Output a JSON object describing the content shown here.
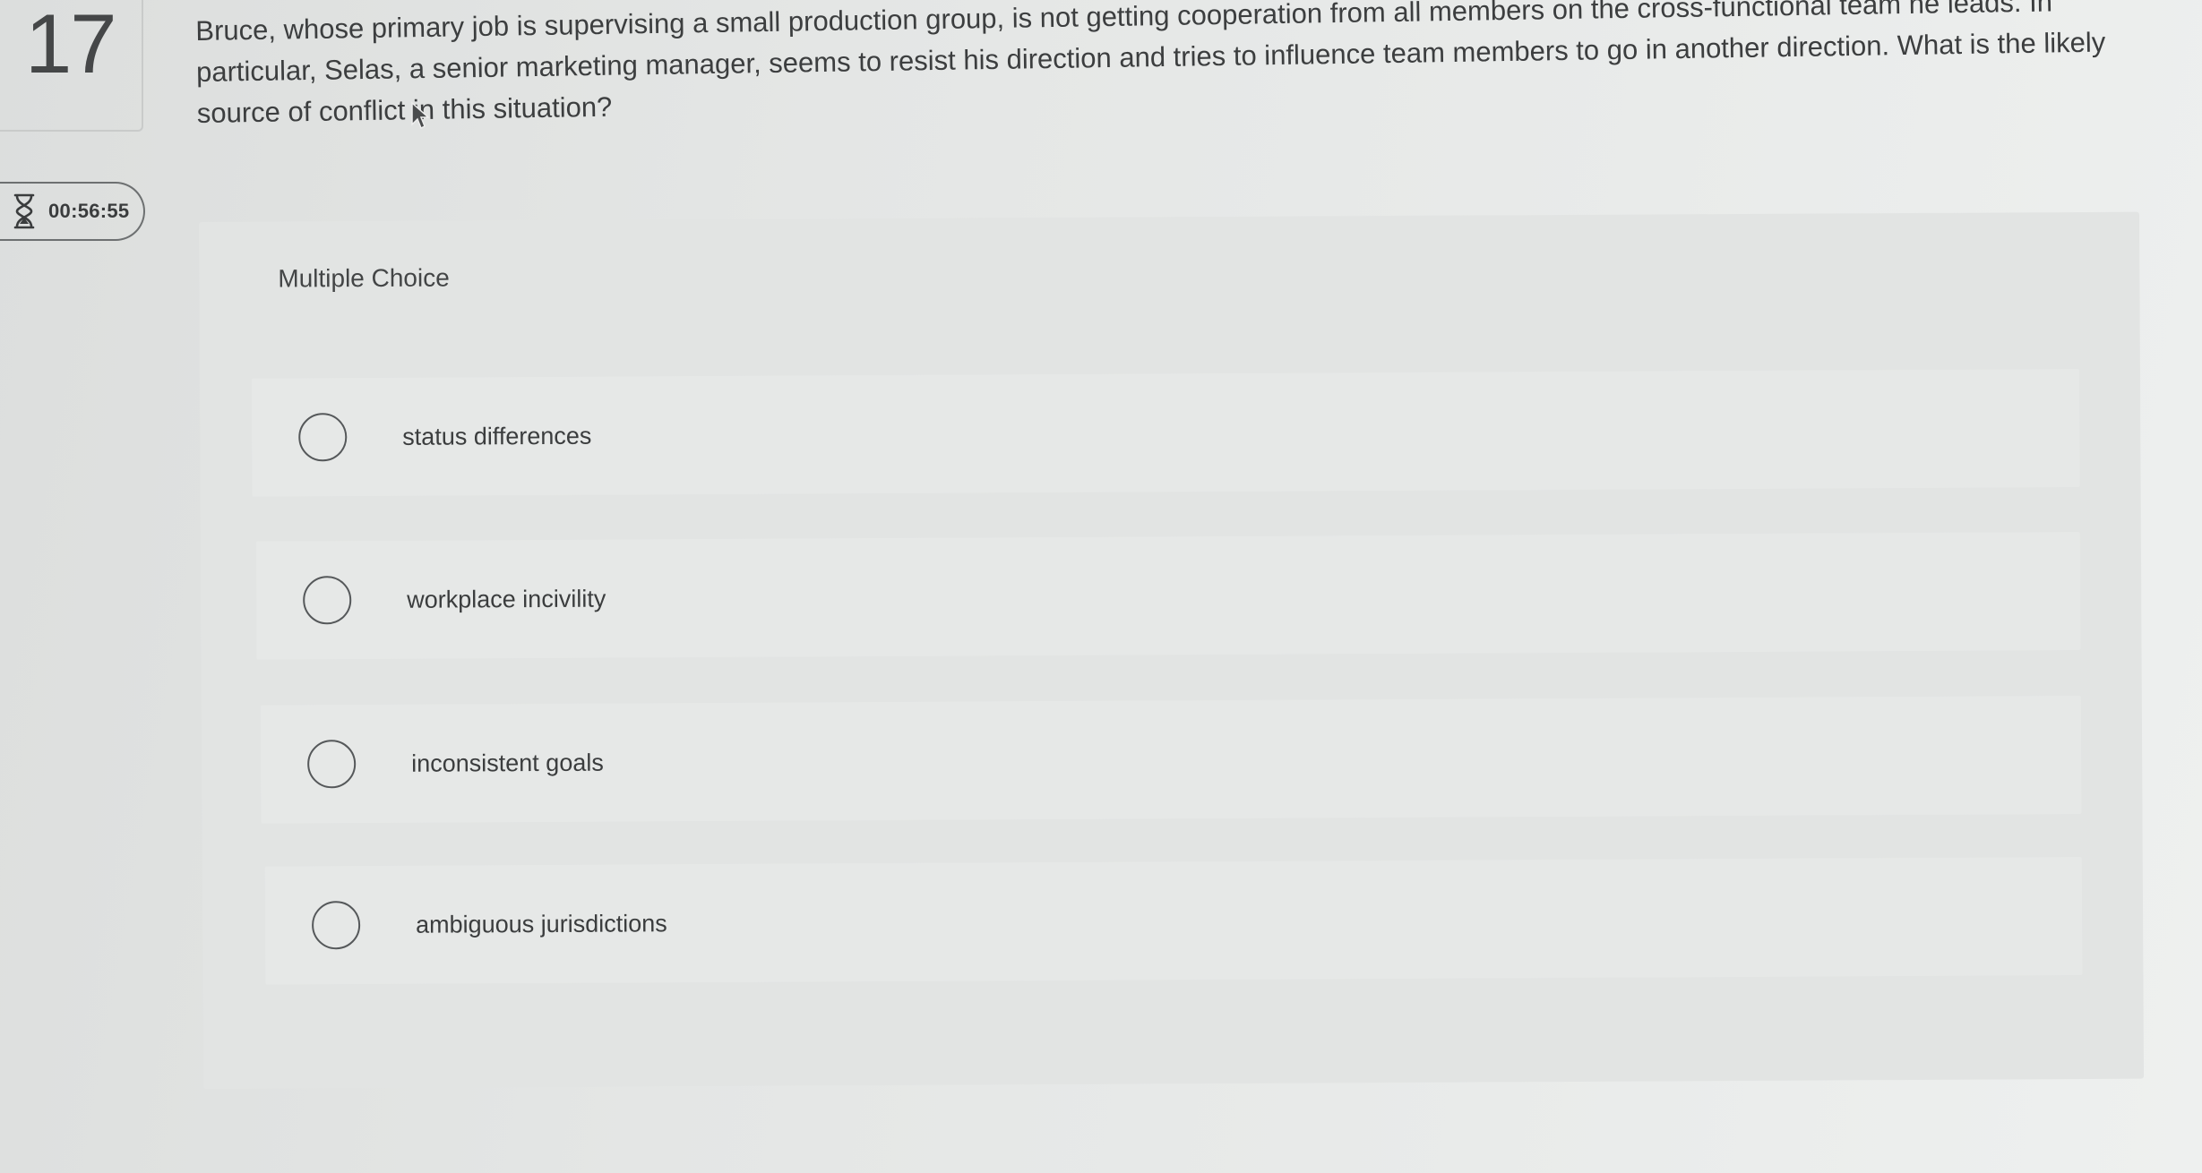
{
  "question": {
    "number": "17",
    "text": "Bruce, whose primary job is supervising a small production group, is not getting cooperation from all members on the cross-functional team he leads. In particular, Selas, a senior marketing manager, seems to resist his direction and tries to influence team members to go in another direction. What is the likely source of conflict in this situation?"
  },
  "timer": {
    "icon": "hourglass-icon",
    "value": "00:56:55"
  },
  "answer_panel": {
    "type_label": "Multiple Choice",
    "options": [
      {
        "label": "status differences"
      },
      {
        "label": "workplace incivility"
      },
      {
        "label": "inconsistent goals"
      },
      {
        "label": "ambiguous jurisdictions"
      }
    ]
  }
}
